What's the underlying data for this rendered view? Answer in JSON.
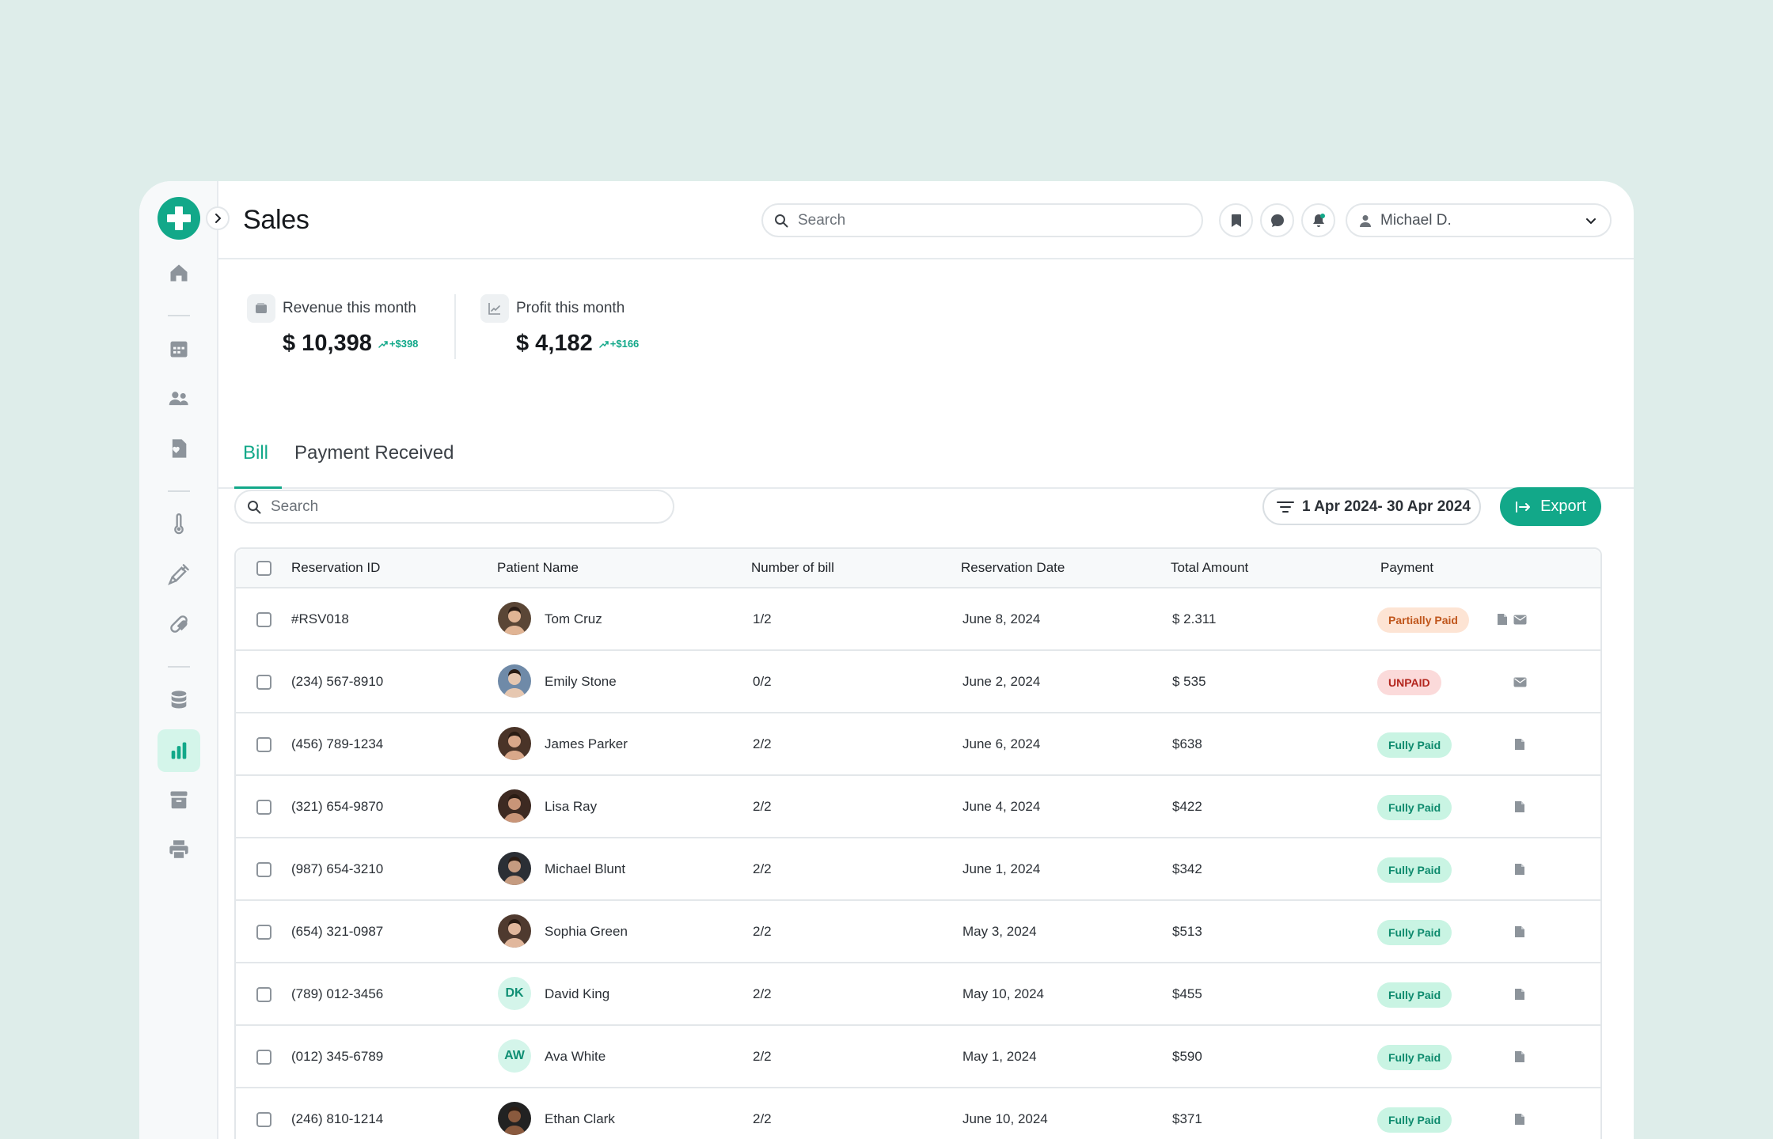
{
  "header": {
    "title": "Sales",
    "search_placeholder": "Search",
    "user_name": "Michael D."
  },
  "stats": {
    "revenue": {
      "label": "Revenue this month",
      "value": "$ 10,398",
      "delta": "+$398"
    },
    "profit": {
      "label": "Profit this month",
      "value": "$ 4,182",
      "delta": "+$166"
    }
  },
  "tabs": [
    {
      "label": "Bill",
      "active": true
    },
    {
      "label": "Payment Received",
      "active": false
    }
  ],
  "toolbar": {
    "search_placeholder": "Search",
    "date_range": "1 Apr 2024- 30 Apr 2024",
    "export_label": "Export"
  },
  "table": {
    "columns": [
      "Reservation ID",
      "Patient Name",
      "Number of bill",
      "Reservation Date",
      "Total Amount",
      "Payment"
    ],
    "rows": [
      {
        "id": "#RSV018",
        "name": "Tom Cruz",
        "bills": "1/2",
        "date": "June 8, 2024",
        "amount": "$ 2.311",
        "payment": "Partially Paid",
        "status": "partial",
        "avatar": "photo",
        "actions": [
          "document-icon",
          "mail-icon"
        ]
      },
      {
        "id": "(234) 567-8910",
        "name": "Emily Stone",
        "bills": "0/2",
        "date": "June 2, 2024",
        "amount": "$ 535",
        "payment": "UNPAID",
        "status": "unpaid",
        "avatar": "photo",
        "actions": [
          "mail-icon"
        ]
      },
      {
        "id": "(456) 789-1234",
        "name": "James Parker",
        "bills": "2/2",
        "date": "June 6, 2024",
        "amount": "$638",
        "payment": "Fully Paid",
        "status": "full",
        "avatar": "photo",
        "actions": [
          "document-icon"
        ]
      },
      {
        "id": "(321) 654-9870",
        "name": "Lisa Ray",
        "bills": "2/2",
        "date": "June 4, 2024",
        "amount": "$422",
        "payment": "Fully Paid",
        "status": "full",
        "avatar": "photo",
        "actions": [
          "document-icon"
        ]
      },
      {
        "id": "(987) 654-3210",
        "name": "Michael Blunt",
        "bills": "2/2",
        "date": "June 1, 2024",
        "amount": "$342",
        "payment": "Fully Paid",
        "status": "full",
        "avatar": "photo",
        "actions": [
          "document-icon"
        ]
      },
      {
        "id": "(654) 321-0987",
        "name": "Sophia Green",
        "bills": "2/2",
        "date": "May 3, 2024",
        "amount": "$513",
        "payment": "Fully Paid",
        "status": "full",
        "avatar": "photo",
        "actions": [
          "document-icon"
        ]
      },
      {
        "id": "(789) 012-3456",
        "name": "David King",
        "bills": "2/2",
        "date": "May 10, 2024",
        "amount": "$455",
        "payment": "Fully Paid",
        "status": "full",
        "avatar": "DK",
        "actions": [
          "document-icon"
        ]
      },
      {
        "id": "(012) 345-6789",
        "name": "Ava White",
        "bills": "2/2",
        "date": "May 1, 2024",
        "amount": "$590",
        "payment": "Fully Paid",
        "status": "full",
        "avatar": "AW",
        "actions": [
          "document-icon"
        ]
      },
      {
        "id": "(246) 810-1214",
        "name": "Ethan Clark",
        "bills": "2/2",
        "date": "June 10, 2024",
        "amount": "$371",
        "payment": "Fully Paid",
        "status": "full",
        "avatar": "photo",
        "actions": [
          "document-icon"
        ]
      }
    ]
  },
  "sidebar": {
    "items": [
      "home-icon",
      "calendar-icon",
      "patients-icon",
      "medical-records-icon",
      "thermometer-icon",
      "syringe-icon",
      "pill-icon",
      "database-icon",
      "sales-chart-icon",
      "archive-icon",
      "printer-icon"
    ],
    "active": "sales-chart-icon"
  },
  "colors": {
    "accent": "#12a889",
    "background": "#deedea",
    "partial": "#c0561c",
    "unpaid": "#b3261e",
    "full": "#0d8a6d"
  }
}
